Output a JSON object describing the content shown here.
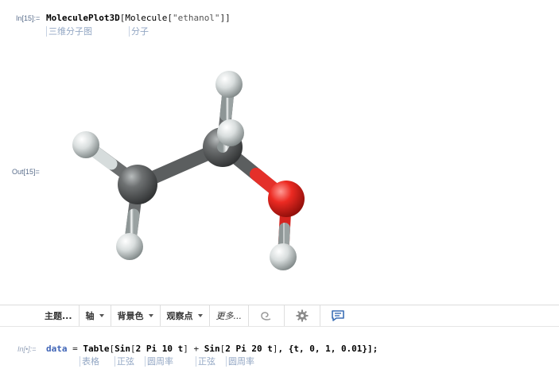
{
  "cell1": {
    "in_label": "In[15]:=",
    "code_func": "MoleculePlot3D",
    "code_open": "[",
    "code_func2": "Molecule",
    "code_open2": "[",
    "code_str": "\"ethanol\"",
    "code_close": "]]",
    "hints": [
      "三维分子图",
      "分子"
    ],
    "out_label": "Out[15]="
  },
  "molecule": {
    "name": "ethanol",
    "atom_colors": {
      "carbon": "#5e6061",
      "hydrogen": "#e6eaea",
      "oxygen": "#e4231f"
    }
  },
  "toolbar": {
    "theme": "主题...",
    "axes": "轴",
    "background": "背景色",
    "viewpoint": "观察点",
    "more": "更多...",
    "icons": [
      "swirl-icon",
      "gear-icon",
      "chat-icon"
    ]
  },
  "cell2": {
    "in_label": "In[•]:=",
    "var": "data",
    "eq": " = ",
    "f1": "Table",
    "b1": "[",
    "f2": "Sin",
    "b2": "[",
    "t1": "2 Pi 10 t",
    "b3": "]",
    "plus": " + ",
    "f3": "Sin",
    "b4": "[",
    "t2": "2 Pi 20 t",
    "b5": "]",
    "rest": ", {t, 0, 1, 0.01}];",
    "hints": [
      "表格",
      "正弦",
      "圆周率",
      "正弦",
      "圆周率"
    ]
  }
}
